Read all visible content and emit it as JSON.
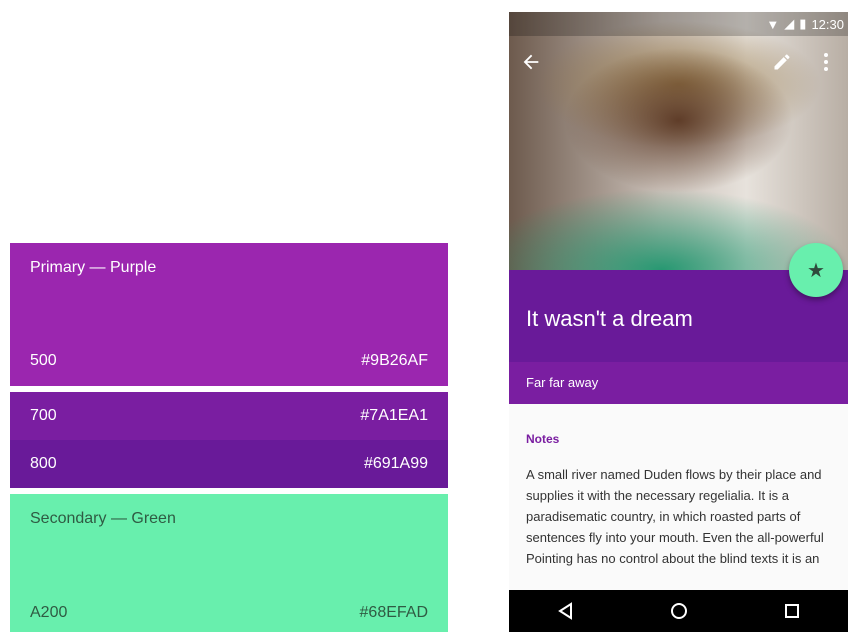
{
  "palette": {
    "primary": {
      "title": "Primary — Purple",
      "shades": [
        {
          "name": "500",
          "hex": "#9B26AF"
        },
        {
          "name": "700",
          "hex": "#7A1EA1"
        },
        {
          "name": "800",
          "hex": "#691A99"
        }
      ]
    },
    "secondary": {
      "title": "Secondary — Green",
      "shades": [
        {
          "name": "A200",
          "hex": "#68EFAD"
        }
      ]
    }
  },
  "phone": {
    "status": {
      "time": "12:30"
    },
    "icons": {
      "back": "arrow-back-icon",
      "edit": "pencil-icon",
      "more": "more-vert-icon",
      "fab": "star-icon",
      "nav": [
        "back-triangle-icon",
        "home-circle-icon",
        "recents-square-icon"
      ]
    },
    "title": "It wasn't a dream",
    "subtitle": "Far far away",
    "notes": {
      "label": "Notes",
      "body": "A small river named Duden flows by their place and supplies it with the necessary regelialia. It is a paradisematic country, in which roasted parts of sentences fly into your mouth. Even the all-powerful Pointing has no control about the blind texts it is an"
    }
  }
}
